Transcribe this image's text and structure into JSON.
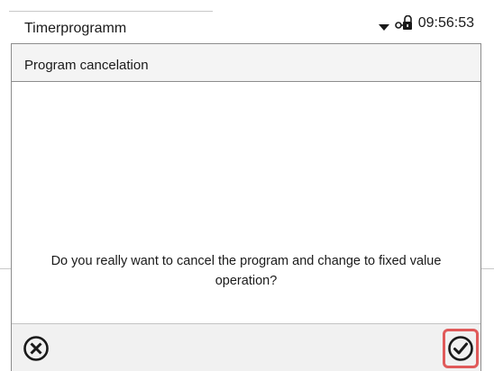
{
  "status_bar": {
    "screen_title": "Timerprogramm",
    "time": "09:56:53",
    "icons": {
      "dropdown": "dropdown-triangle-icon",
      "lock": "key-lock-icon"
    }
  },
  "dialog": {
    "title": "Program cancelation",
    "message": "Do you really want to cancel the program and change to fixed value operation?",
    "buttons": {
      "cancel": {
        "icon": "circle-x-icon"
      },
      "confirm": {
        "icon": "circle-check-icon",
        "highlight_color": "#e05a5a"
      }
    }
  }
}
